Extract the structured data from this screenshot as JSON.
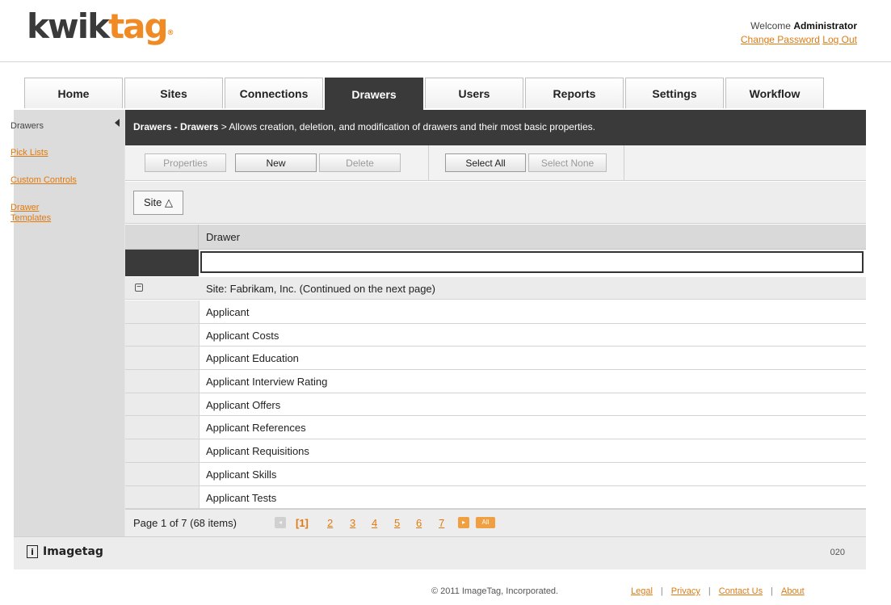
{
  "brand": {
    "logo_part1": "kwik",
    "logo_part2": "tag",
    "logo_mark": "®"
  },
  "header": {
    "welcome_prefix": "Welcome",
    "user": "Administrator",
    "change_password": "Change Password",
    "logout": "Log Out"
  },
  "tabs": [
    {
      "label": "Home"
    },
    {
      "label": "Sites"
    },
    {
      "label": "Connections"
    },
    {
      "label": "Drawers"
    },
    {
      "label": "Users"
    },
    {
      "label": "Reports"
    },
    {
      "label": "Settings"
    },
    {
      "label": "Workflow"
    }
  ],
  "active_tab": "Drawers",
  "sidebar": {
    "items": [
      {
        "label": "Drawers"
      },
      {
        "label": "Pick Lists"
      },
      {
        "label": "Custom Controls"
      },
      {
        "label": "Drawer Templates"
      }
    ]
  },
  "breadcrumb": {
    "title": "Drawers - Drawers",
    "description": " > Allows creation, deletion, and modification of drawers and their most basic properties."
  },
  "toolbar": {
    "properties": "Properties",
    "new": "New",
    "delete": "Delete",
    "select_all": "Select All",
    "select_none": "Select None"
  },
  "grouping": {
    "site_chip": "Site △"
  },
  "grid": {
    "column_header": "Drawer",
    "filter_value": "",
    "group_label": "Site: Fabrikam, Inc. (Continued on the next page)",
    "rows": [
      "Applicant",
      "Applicant Costs",
      "Applicant Education",
      "Applicant Interview Rating",
      "Applicant Offers",
      "Applicant References",
      "Applicant Requisitions",
      "Applicant Skills",
      "Applicant Tests"
    ]
  },
  "pager": {
    "info": "Page 1 of 7 (68 items)",
    "pages": [
      "[1]",
      "2",
      "3",
      "4",
      "5",
      "6",
      "7"
    ],
    "all_label": "All"
  },
  "footer": {
    "imagetag": "Imagetag",
    "imagetag_mark": "i",
    "code": "020",
    "copyright": "© 2011 ImageTag, Incorporated.",
    "links": [
      "Legal",
      "Privacy",
      "Contact Us",
      "About"
    ]
  },
  "colors": {
    "accent": "#e07a10",
    "dark_bar": "#3a3a3a"
  }
}
